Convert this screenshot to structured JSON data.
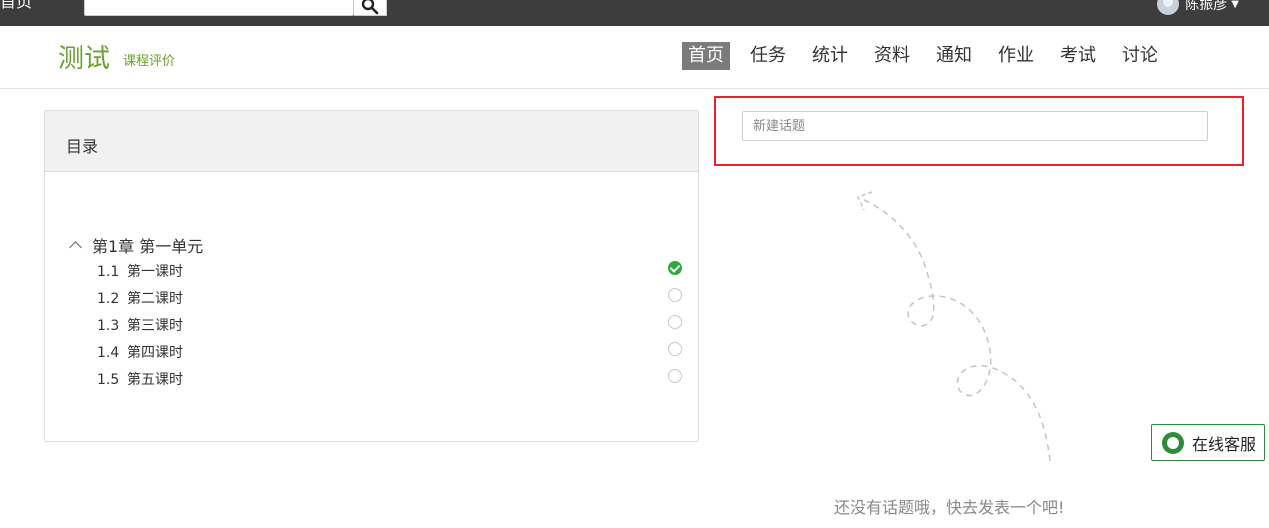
{
  "topbar": {
    "home_label": "首页",
    "search_placeholder": "",
    "user_name": "陈振彦"
  },
  "course": {
    "title": "测试",
    "subtitle": "课程评价"
  },
  "nav": [
    "首页",
    "任务",
    "统计",
    "资料",
    "通知",
    "作业",
    "考试",
    "讨论"
  ],
  "nav_active": "首页",
  "catalog": {
    "title": "目录",
    "chapter": "第1章 第一单元",
    "lessons": [
      {
        "num": "1.1",
        "name": "第一课时",
        "done": true
      },
      {
        "num": "1.2",
        "name": "第二课时",
        "done": false
      },
      {
        "num": "1.3",
        "name": "第三课时",
        "done": false
      },
      {
        "num": "1.4",
        "name": "第四课时",
        "done": false
      },
      {
        "num": "1.5",
        "name": "第五课时",
        "done": false
      }
    ]
  },
  "discussion": {
    "new_topic_placeholder": "新建话题",
    "empty_message": "还没有话题哦，快去发表一个吧!"
  },
  "support": {
    "label": "在线客服"
  },
  "colors": {
    "brand": "#6aa12e",
    "highlight": "#e8232a",
    "done": "#2dab3c",
    "support": "#2e8b3a"
  }
}
